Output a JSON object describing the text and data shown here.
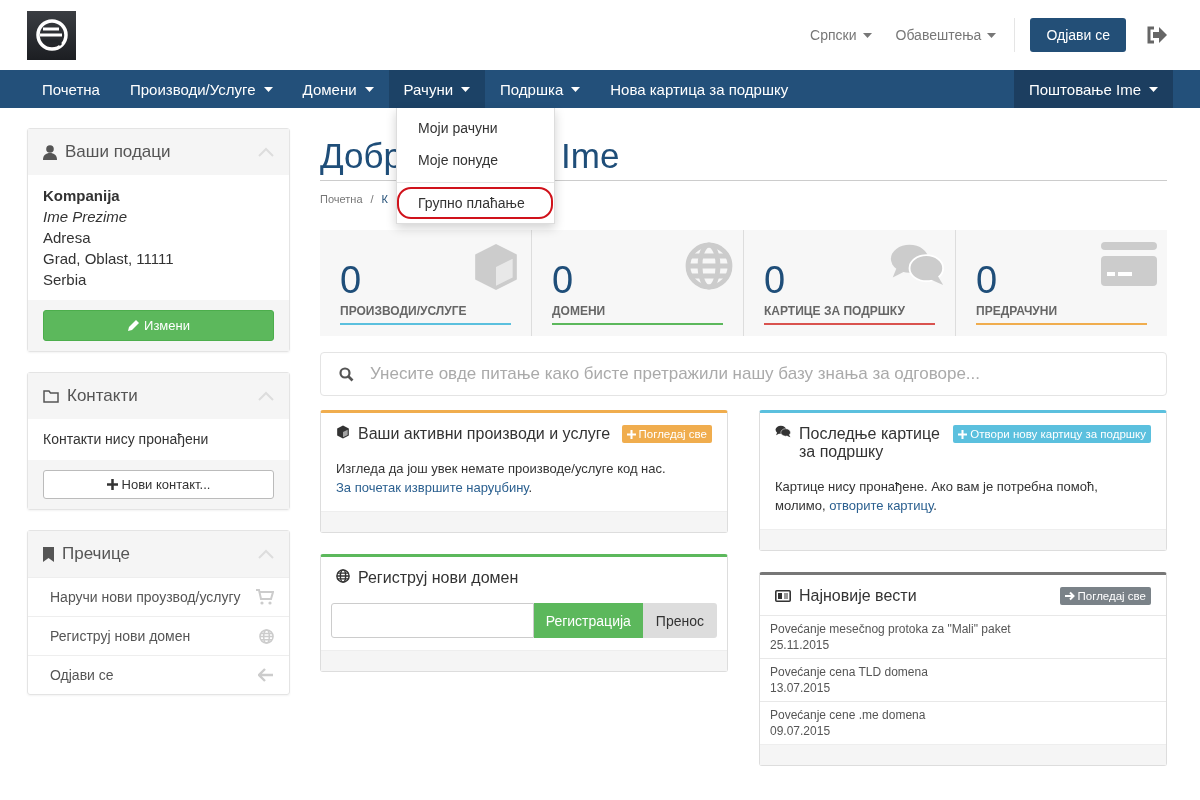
{
  "header": {
    "language": "Српски",
    "notifications": "Обавештења",
    "logout_button": "Одјави се"
  },
  "nav": {
    "items": [
      {
        "label": "Почетна",
        "caret": false,
        "selected": false
      },
      {
        "label": "Производи/Услуге",
        "caret": true,
        "selected": false
      },
      {
        "label": "Домени",
        "caret": true,
        "selected": false
      },
      {
        "label": "Рачуни",
        "caret": true,
        "selected": true
      },
      {
        "label": "Подршка",
        "caret": true,
        "selected": false
      },
      {
        "label": "Нова картица за подршку",
        "caret": false,
        "selected": false
      }
    ],
    "user_menu": {
      "label": "Поштовање Ime",
      "caret": true
    }
  },
  "dropdown": {
    "items": [
      {
        "kind": "link",
        "label": "Моји рачуни",
        "highlighted": false
      },
      {
        "kind": "link",
        "label": "Моје понуде",
        "highlighted": false
      },
      {
        "kind": "divider"
      },
      {
        "kind": "link",
        "label": "Групно плаћање",
        "highlighted": true
      }
    ]
  },
  "page_title": {
    "visible_start": "Добр",
    "visible_end": "Ime"
  },
  "breadcrumb": {
    "separator": "/",
    "items": [
      "Почетна",
      "К"
    ]
  },
  "sidebar": {
    "profile": {
      "title": "Ваши подаци",
      "company": "Kompanija",
      "name": "Ime Prezime",
      "lines": [
        "Adresa",
        "Grad, Oblast, 11111",
        "Serbia"
      ],
      "button": "Измени"
    },
    "contacts": {
      "title": "Контакти",
      "empty": "Контакти нису пронађени",
      "button": "Нови контакт..."
    },
    "shortcuts": {
      "title": "Пречице",
      "items": [
        "Наручи нови проузвод/услугу",
        "Региструј нови домен",
        "Одјави се"
      ]
    }
  },
  "stats": [
    {
      "count": "0",
      "label": "ПРОИЗВОДИ/УСЛУГЕ",
      "color": "#5bc0de"
    },
    {
      "count": "0",
      "label": "ДОМЕНИ",
      "color": "#5cb85c"
    },
    {
      "count": "0",
      "label": "КАРТИЦЕ ЗА ПОДРШКУ",
      "color": "#d9534f"
    },
    {
      "count": "0",
      "label": "ПРЕДРАЧУНИ",
      "color": "#f0ad4e"
    }
  ],
  "search": {
    "placeholder": "Унесите овде питање како бисте претражили нашу базу знања за одговоре..."
  },
  "products_panel": {
    "title": "Ваши активни производи и услуге",
    "button": "Погледај све",
    "text": "Изгледа да још увек немате производе/услуге код нас.",
    "link": "За почетак извршите наруџбину",
    "end": "."
  },
  "domain_panel": {
    "title": "Региструј нови домен",
    "register_button": "Регистрација",
    "transfer_button": "Пренос"
  },
  "tickets_panel": {
    "title": "Последње картице за подршку",
    "button": "Отвори нову картицу за подршку",
    "text": "Картице нису пронађене. Ако вам је потребна помоћ, молимо,",
    "link": "отворите картицу",
    "end": "."
  },
  "news_panel": {
    "title": "Најновије вести",
    "button": "Погледај све",
    "items": [
      {
        "title": "Povećanje mesečnog protoka za \"Mali\" paket",
        "date": "25.11.2015"
      },
      {
        "title": "Povećanje cena TLD domena",
        "date": "13.07.2015"
      },
      {
        "title": "Povećanje cene .me domena",
        "date": "09.07.2015"
      }
    ]
  }
}
